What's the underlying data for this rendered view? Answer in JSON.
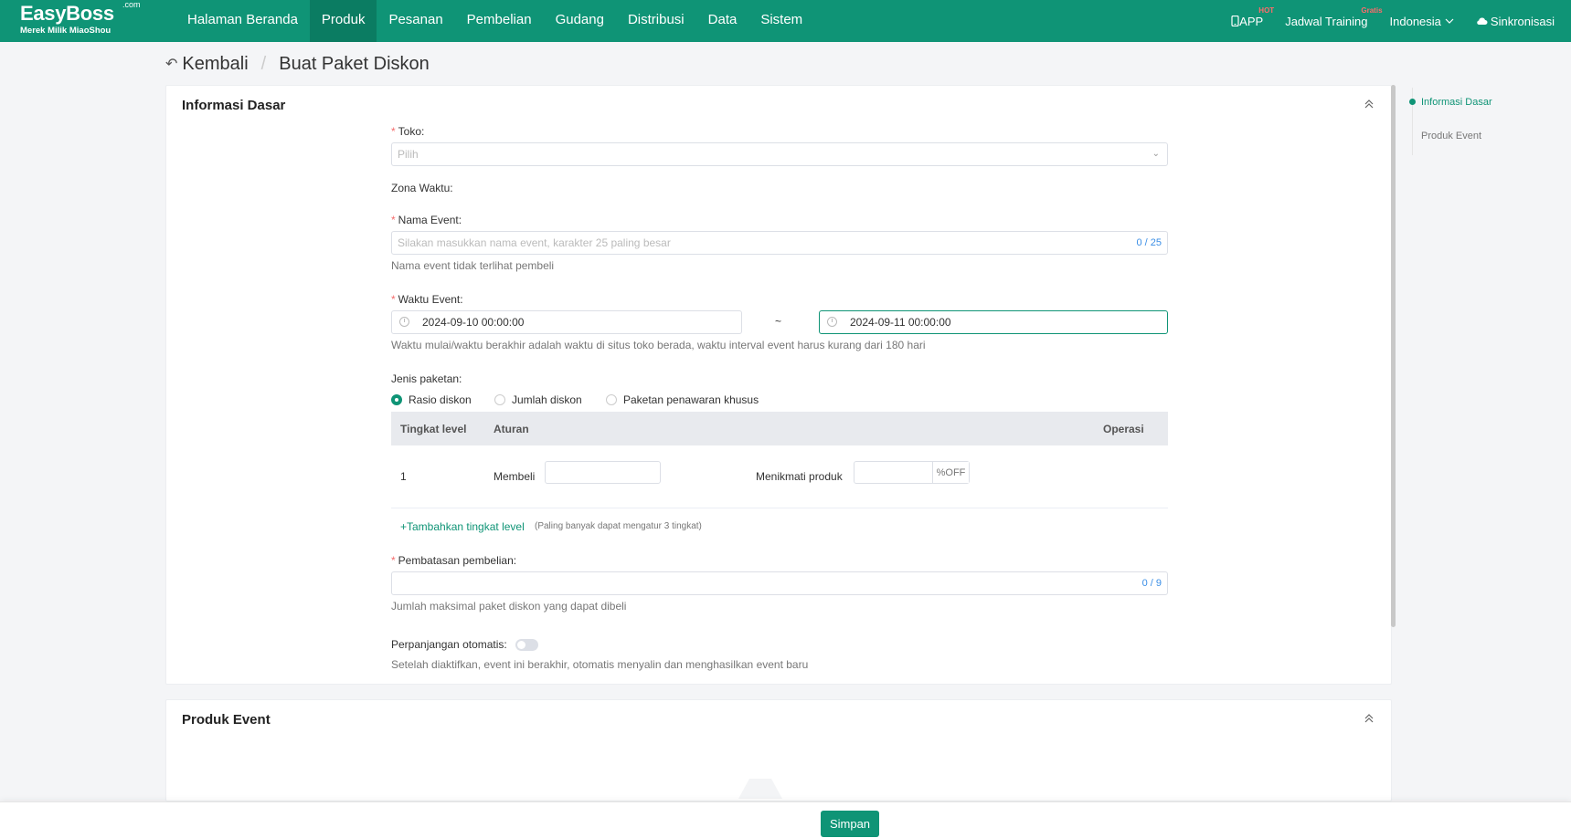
{
  "nav": {
    "logo_brand": "EasyBoss",
    "logo_com": ".com",
    "logo_sub": "Merek Milik MiaoShou",
    "menu": [
      "Halaman Beranda",
      "Produk",
      "Pesanan",
      "Pembelian",
      "Gudang",
      "Distribusi",
      "Data",
      "Sistem"
    ],
    "active_menu": "Produk",
    "app_label": "APP",
    "app_badge": "HOT",
    "training_label": "Jadwal Training",
    "training_badge": "Gratis",
    "language": "Indonesia",
    "sync_label": "Sinkronisasi"
  },
  "breadcrumb": {
    "back": "Kembali",
    "current": "Buat Paket Diskon"
  },
  "basic": {
    "title": "Informasi Dasar",
    "store_label": "Toko:",
    "store_placeholder": "Pilih",
    "timezone_label": "Zona Waktu:",
    "event_name_label": "Nama Event:",
    "event_name_placeholder": "Silakan masukkan nama event, karakter 25 paling besar",
    "event_name_counter": "0 / 25",
    "event_name_hint": "Nama event tidak terlihat pembeli",
    "event_time_label": "Waktu Event:",
    "start_time": "2024-09-10 00:00:00",
    "time_separator": "~",
    "end_time": "2024-09-11 00:00:00",
    "event_time_hint": "Waktu mulai/waktu berakhir adalah waktu di situs toko berada, waktu interval event harus kurang dari 180 hari",
    "package_type_label": "Jenis paketan:",
    "package_types": [
      "Rasio diskon",
      "Jumlah diskon",
      "Paketan penawaran khusus"
    ],
    "selected_package_type": "Rasio diskon",
    "table_headers": {
      "level": "Tingkat level",
      "rule": "Aturan",
      "operation": "Operasi"
    },
    "row": {
      "level": "1",
      "buy_label": "Membeli",
      "enjoy_label": "Menikmati produk",
      "suffix": "%OFF"
    },
    "add_level": "+Tambahkan tingkat level",
    "add_level_note": "(Paling banyak dapat mengatur 3 tingkat)",
    "limit_label": "Pembatasan pembelian:",
    "limit_counter": "0 / 9",
    "limit_hint": "Jumlah maksimal paket diskon yang dapat dibeli",
    "auto_extend_label": "Perpanjangan otomatis:",
    "auto_extend_on": false,
    "auto_extend_hint": "Setelah diaktifkan, event ini berakhir, otomatis menyalin dan menghasilkan event baru"
  },
  "products": {
    "title": "Produk Event"
  },
  "anchor": [
    "Informasi Dasar",
    "Produk Event"
  ],
  "save_label": "Simpan",
  "colors": {
    "primary": "#0f9476",
    "required": "#f56c6c",
    "counter": "#3a8ee6"
  }
}
